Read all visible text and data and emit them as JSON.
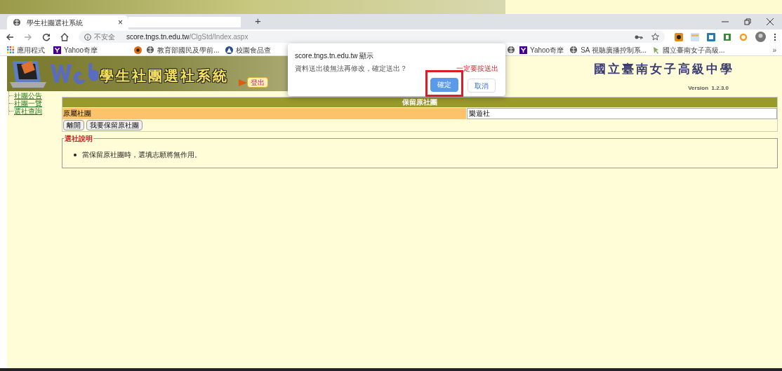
{
  "browser": {
    "tab": {
      "title": "學生社團選社系統",
      "close": "×",
      "selected": true
    },
    "new_tab": "+",
    "address": {
      "security": "不安全",
      "host": "score.tngs.tn.edu.tw",
      "path": "/ClgStd/Index.aspx"
    },
    "bookmarks": [
      {
        "label": "應用程式",
        "kind": "apps"
      },
      {
        "label": "Yahoo奇摩",
        "kind": "yahoo"
      },
      {
        "kind": "orange"
      },
      {
        "label": "教育部國民及學前...",
        "kind": "globe"
      },
      {
        "label": "校園食品查",
        "kind": "triangle"
      },
      {
        "kind": "globe"
      },
      {
        "label": "Yahoo奇摩",
        "kind": "yahoo"
      },
      {
        "label": "SA 視聽廣播控制系...",
        "kind": "globe"
      },
      {
        "label": "國立臺南女子高級...",
        "kind": "pin"
      }
    ],
    "more": "»"
  },
  "page": {
    "system_title": "學生社團選社系統",
    "logout": "登出",
    "school": "國立臺南女子高級中學",
    "version": "Version  1.2.3.0",
    "sidebar": {
      "items": [
        {
          "label": "社團公告"
        },
        {
          "label": "社團一覽"
        },
        {
          "label": "選社查詢"
        }
      ]
    },
    "panel": {
      "title": "保留原社團",
      "field_label": "原屬社團",
      "field_value": "樂遊社",
      "buttons": [
        "離開",
        "我要保留原社團"
      ]
    },
    "notes": {
      "legend": "選社說明",
      "items": [
        "當保留原社團時，選填志願將無作用。"
      ]
    }
  },
  "dialog": {
    "title": "score.tngs.tn.edu.tw 顯示",
    "message": "資料送出後無法再修改，確定送出？",
    "annotation": "一定要按送出",
    "buttons": [
      {
        "label": "確定",
        "kind": "primary",
        "highlighted": true
      },
      {
        "label": "取消",
        "kind": "secondary",
        "highlighted": false
      }
    ]
  }
}
